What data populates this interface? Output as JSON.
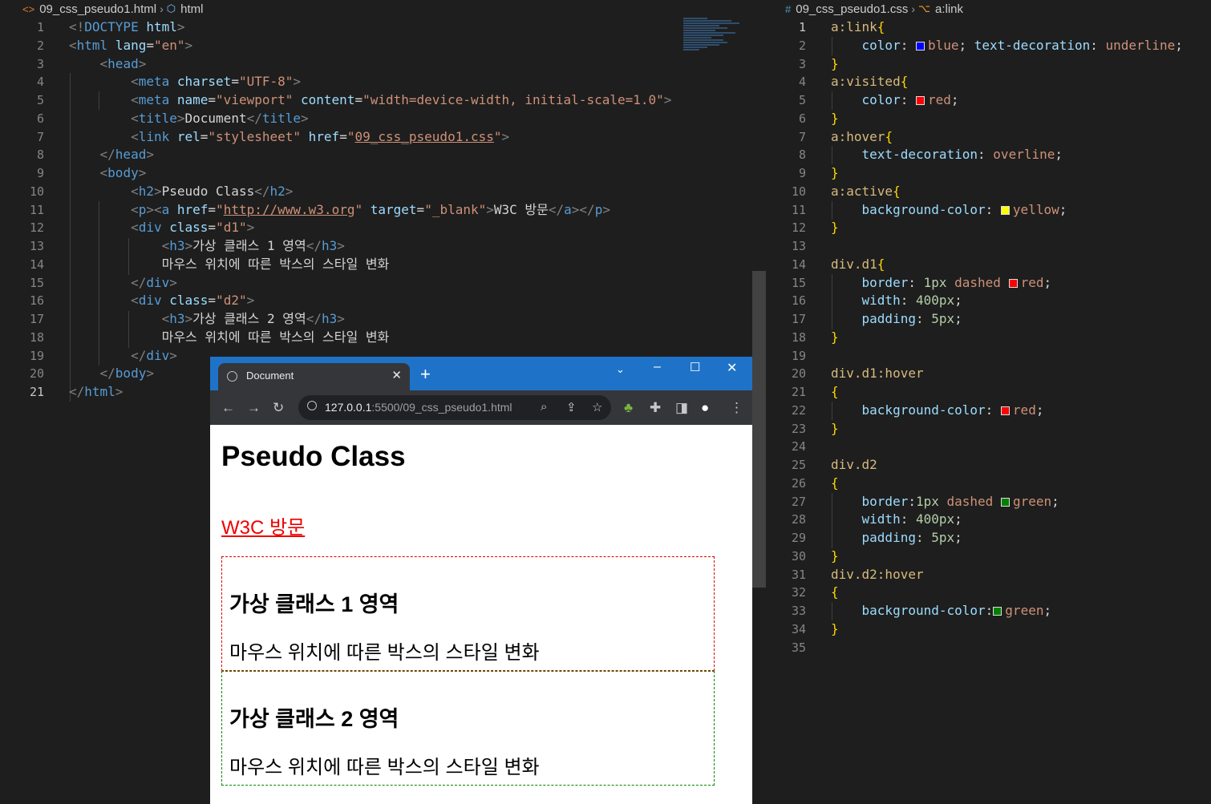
{
  "editor_left": {
    "breadcrumb": {
      "file": "09_css_pseudo1.html",
      "symbol": "html"
    },
    "active_line": 21
  },
  "editor_right": {
    "breadcrumb": {
      "file": "09_css_pseudo1.css",
      "symbol": "a:link"
    },
    "active_line": 1
  },
  "browser": {
    "tab_title": "Document",
    "url_host": "127.0.0.1",
    "url_rest": ":5500/09_css_pseudo1.html",
    "page": {
      "heading": "Pseudo Class",
      "link_text": "W3C 방문",
      "box1_heading": "가상 클래스 1 영역",
      "box1_text": "마우스 위치에 따른 박스의 스타일 변화",
      "box2_heading": "가상 클래스 2 영역",
      "box2_text": "마우스 위치에 따른 박스의 스타일 변화"
    }
  },
  "colors": {
    "link_swatch": "#0000ff",
    "red": "#ff0000",
    "yellow": "#ffff00",
    "green": "#008000"
  },
  "icons": [
    "html-file-icon",
    "css-hash-icon",
    "symbol-icon",
    "globe-icon",
    "back-arrow-icon",
    "forward-arrow-icon",
    "reload-icon",
    "info-icon",
    "zoom-icon",
    "share-icon",
    "star-icon",
    "tree-extension-icon",
    "puzzle-icon",
    "sidebar-icon",
    "profile-icon",
    "kebab-menu-icon",
    "minimize-icon",
    "maximize-icon",
    "close-icon",
    "chevron-down-icon",
    "new-tab-icon"
  ]
}
